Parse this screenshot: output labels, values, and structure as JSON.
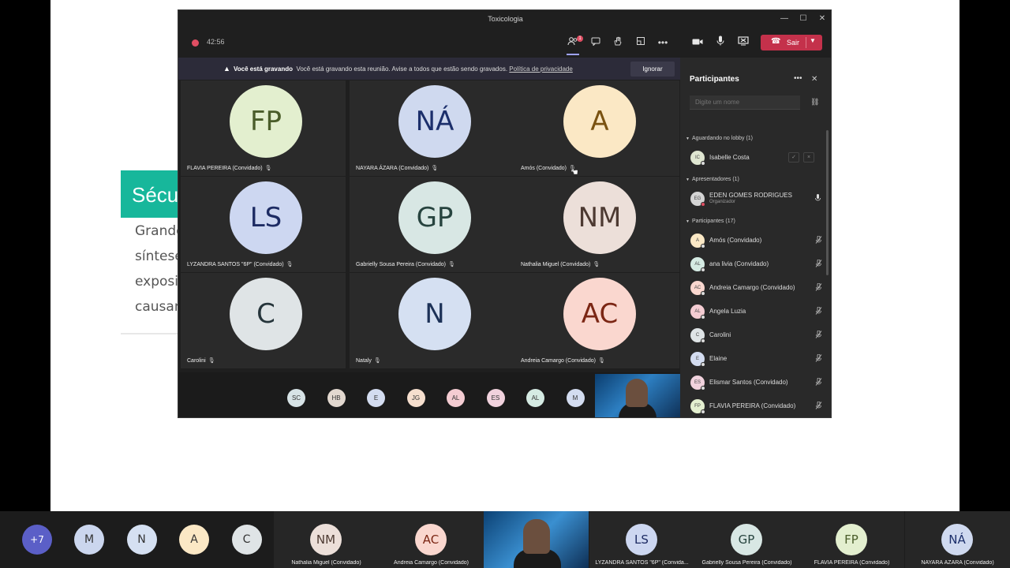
{
  "slide": {
    "heading_fragment": "Sécu",
    "lines": [
      "Grande",
      "síntese",
      "exposi",
      "causar"
    ]
  },
  "window": {
    "title": "Toxicologia",
    "controls": {
      "minimize": "—",
      "maximize": "☐",
      "close": "✕"
    }
  },
  "toolbar": {
    "recording_time": "42:56",
    "participants_badge": "1",
    "leave_label": "Sair",
    "icons": [
      "participants-icon",
      "chat-icon",
      "raise-hand-icon",
      "rooms-icon",
      "more-icon",
      "camera-icon",
      "microphone-icon",
      "share-screen-icon"
    ]
  },
  "banner": {
    "bold": "Você está gravando",
    "text": "Você está gravando esta reunião. Avise a todos que estão sendo gravados.",
    "link": "Política de privacidade",
    "ignore_label": "Ignorar"
  },
  "grid": [
    {
      "initials": "FP",
      "name": "FLAVIA PEREIRA (Convidado)",
      "bg": "#e3efcf",
      "fg": "#4a5d2a"
    },
    {
      "initials": "NÁ",
      "name": "NAYARA ÁZARA (Convidado)",
      "bg": "#cfd9ef",
      "fg": "#1c2f6b"
    },
    {
      "initials": "A",
      "name": "Amós (Convidado)",
      "bg": "#fbe8c5",
      "fg": "#7a5211"
    },
    {
      "initials": "LS",
      "name": "LYZANDRA SANTOS \"6P\" (Convidado)",
      "bg": "#cdd7f1",
      "fg": "#1d2b63"
    },
    {
      "initials": "GP",
      "name": "Gabrielly Sousa Pereira (Convidado)",
      "bg": "#d8e7e4",
      "fg": "#27443f"
    },
    {
      "initials": "NM",
      "name": "Nathalia Miguel (Convidado)",
      "bg": "#ecdfd9",
      "fg": "#4d3a32"
    },
    {
      "initials": "C",
      "name": "Carolini",
      "bg": "#dfe4e6",
      "fg": "#26353b"
    },
    {
      "initials": "N",
      "name": "Nataly",
      "bg": "#d5e0f2",
      "fg": "#1c3157"
    },
    {
      "initials": "AC",
      "name": "Andreia Camargo (Convidado)",
      "bg": "#fad7cf",
      "fg": "#7b2614"
    }
  ],
  "strip": [
    {
      "initials": "SC",
      "bg": "#d7e3e6"
    },
    {
      "initials": "HB",
      "bg": "#e2d8cf"
    },
    {
      "initials": "E",
      "bg": "#d3dcf0"
    },
    {
      "initials": "JG",
      "bg": "#f6dfce"
    },
    {
      "initials": "AL",
      "bg": "#f4ccd2"
    },
    {
      "initials": "ES",
      "bg": "#f1d2dd"
    },
    {
      "initials": "AL",
      "bg": "#d5ebe3"
    },
    {
      "initials": "M",
      "bg": "#d3dcf0"
    }
  ],
  "panel": {
    "title": "Participantes",
    "search_placeholder": "Digite um nome",
    "lobby_header": "Aguardando no lobby (1)",
    "lobby": [
      {
        "initials": "IC",
        "name": "Isabelle Costa",
        "bg": "#dfe6d1"
      }
    ],
    "presenters_header": "Apresentadores (1)",
    "presenters": [
      {
        "initials": "EG",
        "name": "EDEN GOMES RODRIGUES",
        "role": "Organizador",
        "bg": "#d4d4d4"
      }
    ],
    "participants_header": "Participantes (17)",
    "participants": [
      {
        "initials": "A",
        "name": "Amós (Convidado)",
        "bg": "#fbe8c5"
      },
      {
        "initials": "AL",
        "name": "ana livia (Convidado)",
        "bg": "#d5ebe3"
      },
      {
        "initials": "AC",
        "name": "Andreia Camargo (Convidado)",
        "bg": "#fad7cf"
      },
      {
        "initials": "AL",
        "name": "Angela Luzia",
        "bg": "#f4ccd2"
      },
      {
        "initials": "C",
        "name": "Carolini",
        "bg": "#dfe4e6"
      },
      {
        "initials": "E",
        "name": "Elaine",
        "bg": "#d3dcf0"
      },
      {
        "initials": "ES",
        "name": "Elismar Santos (Convidado)",
        "bg": "#f1d2dd"
      },
      {
        "initials": "FP",
        "name": "FLAVIA PEREIRA (Convidado)",
        "bg": "#e3efcf"
      }
    ]
  },
  "gallery": {
    "overflow_label": "+7",
    "circles": [
      {
        "initials": "M",
        "bg": "#cbd6ee"
      },
      {
        "initials": "N",
        "bg": "#d5e0f2"
      },
      {
        "initials": "A",
        "bg": "#fbe8c5"
      },
      {
        "initials": "C",
        "bg": "#dfe4e6"
      }
    ],
    "tiles": [
      {
        "initials": "NM",
        "name": "Nathalia Miguel (Convidado)",
        "bg": "#ecdfd9",
        "fg": "#4d3a32"
      },
      {
        "initials": "AC",
        "name": "Andreia Camargo (Convidado)",
        "bg": "#fad7cf",
        "fg": "#7b2614"
      },
      {
        "initials": "LS",
        "name": "LYZANDRA SANTOS \"6P\" (Convida...",
        "bg": "#cdd7f1",
        "fg": "#1d2b63"
      },
      {
        "initials": "GP",
        "name": "Gabrielly Sousa Pereira (Convidado)",
        "bg": "#d8e7e4",
        "fg": "#27443f"
      },
      {
        "initials": "FP",
        "name": "FLAVIA PEREIRA (Convidado)",
        "bg": "#e3efcf",
        "fg": "#4a5d2a"
      },
      {
        "initials": "NÁ",
        "name": "NAYARA ÁZARA (Convidado)",
        "bg": "#cfd9ef",
        "fg": "#1c2f6b"
      }
    ]
  },
  "colors": {
    "accent": "#9ea2ff",
    "leave": "#c4314b",
    "slide_band": "#17b79b"
  }
}
